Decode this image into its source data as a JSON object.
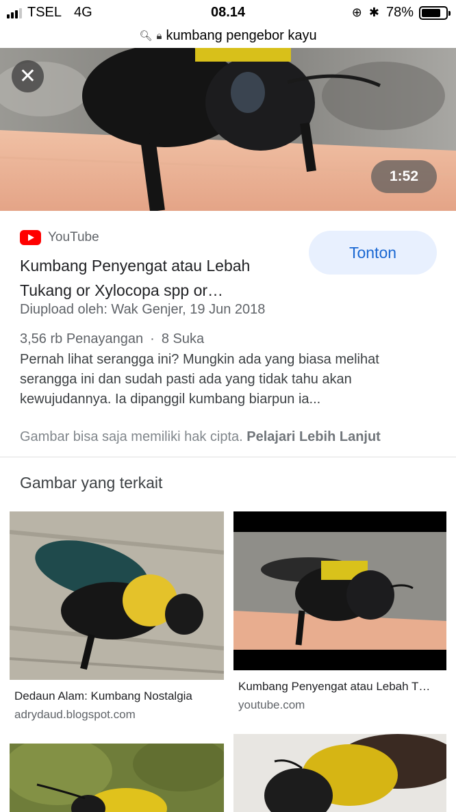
{
  "status_bar": {
    "carrier": "TSEL",
    "network": "4G",
    "time": "08.14",
    "battery": "78%"
  },
  "url_bar": {
    "text": "kumbang pengebor kayu"
  },
  "hero": {
    "duration": "1:52"
  },
  "result": {
    "source": "YouTube",
    "watch_label": "Tonton",
    "title": "Kumbang Penyengat atau Lebah Tukang or Xylocopa spp or…",
    "uploader": "Diupload oleh: Wak Genjer, 19 Jun 2018",
    "views": "3,56 rb Penayangan",
    "separator": "·",
    "likes": "8 Suka",
    "description": "Pernah lihat serangga ini? Mungkin ada yang biasa melihat serangga ini dan sudah pasti ada yang tidak tahu akan kewujudannya. Ia dipanggil kumbang biarpun ia...",
    "copyright_text": "Gambar bisa saja memiliki hak cipta.",
    "learn_more": "Pelajari Lebih Lanjut"
  },
  "related": {
    "heading": "Gambar yang terkait",
    "items": [
      {
        "title": "Dedaun Alam: Kumbang Nostalgia",
        "site": "adrydaud.blogspot.com"
      },
      {
        "title": "Kumbang Penyengat atau Lebah T…",
        "site": "youtube.com"
      }
    ]
  }
}
